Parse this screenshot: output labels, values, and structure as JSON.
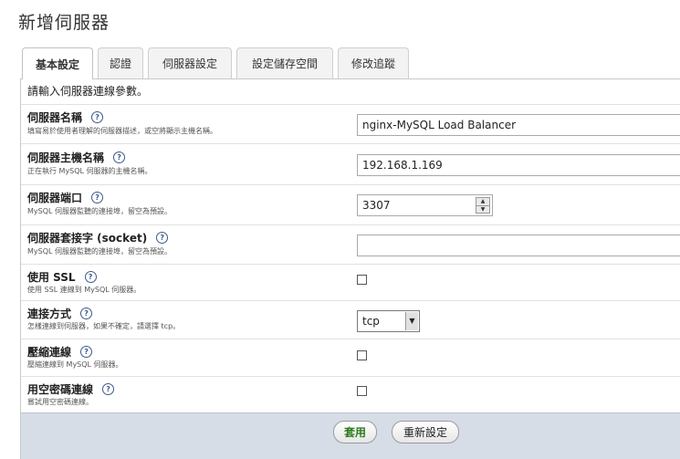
{
  "page": {
    "title": "新增伺服器"
  },
  "tabs": [
    {
      "label": "基本設定",
      "active": true
    },
    {
      "label": "認證"
    },
    {
      "label": "伺服器設定"
    },
    {
      "label": "設定儲存空間"
    },
    {
      "label": "修改追蹤"
    }
  ],
  "intro": "請輸入伺服器連線參數。",
  "help_glyph": "?",
  "fields": {
    "name": {
      "label": "伺服器名稱",
      "desc": "填寫易於使用者理解的伺服器描述，或空將顯示主機名稱。",
      "value": "nginx-MySQL Load Balancer"
    },
    "host": {
      "label": "伺服器主機名稱",
      "desc": "正在執行 MySQL 伺服器的主機名稱。",
      "value": "192.168.1.169"
    },
    "port": {
      "label": "伺服器端口",
      "desc": "MySQL 伺服器監聽的連接埠，留空為預設。",
      "value": "3307"
    },
    "socket": {
      "label": "伺服器套接字 (socket)",
      "desc": "MySQL 伺服器監聽的連接埠，留空為預設。",
      "value": ""
    },
    "ssl": {
      "label": "使用 SSL",
      "desc": "使用 SSL 連線到 MySQL 伺服器。",
      "checked": false
    },
    "connect_type": {
      "label": "連接方式",
      "desc": "怎樣連線到伺服器，如果不確定，請選擇 tcp。",
      "value": "tcp"
    },
    "compress": {
      "label": "壓縮連線",
      "desc": "壓縮連線到 MySQL 伺服器。",
      "checked": false
    },
    "nopassword": {
      "label": "用空密碼連線",
      "desc": "嘗試用空密碼連線。",
      "checked": false
    }
  },
  "buttons": {
    "apply": "套用",
    "reset": "重新設定"
  },
  "colors": {
    "apply_text": "#2a7a1a",
    "footer_bg": "#d6dde6",
    "help": "#3b5a8c"
  }
}
